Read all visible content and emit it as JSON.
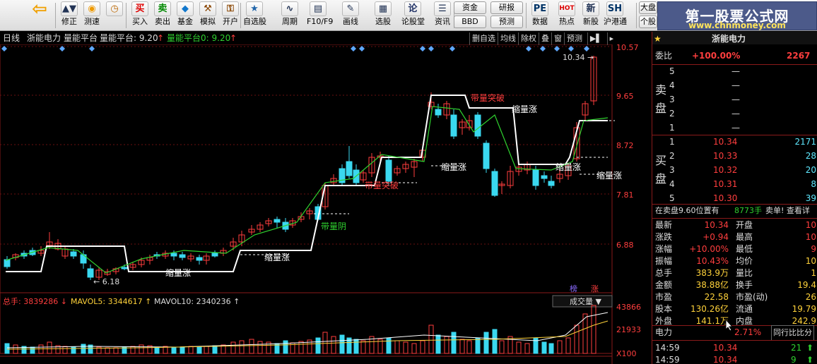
{
  "toolbar": {
    "buttons": [
      {
        "label": "修正",
        "icon": "up-down-arrows-icon",
        "icon_text": "▲▼"
      },
      {
        "label": "测速",
        "icon": "lightbulb-icon",
        "icon_text": "◉"
      },
      {
        "label": "",
        "icon": "clock-icon",
        "icon_text": "◷"
      },
      {
        "label": "买入",
        "icon": "buy-icon",
        "icon_text": "买"
      },
      {
        "label": "卖出",
        "icon": "sell-icon",
        "icon_text": "卖"
      },
      {
        "label": "基金",
        "icon": "fund-icon",
        "icon_text": "◆"
      },
      {
        "label": "模拟",
        "icon": "gavel-icon",
        "icon_text": "⚒"
      },
      {
        "label": "开户",
        "icon": "lock-icon",
        "icon_text": "⚿"
      },
      {
        "label": "自选股",
        "icon": "star-icon",
        "icon_text": "★"
      },
      {
        "label": "周期",
        "icon": "period-icon",
        "icon_text": "∿"
      },
      {
        "label": "F10/F9",
        "icon": "f10-icon",
        "icon_text": "▤"
      },
      {
        "label": "画线",
        "icon": "pen-icon",
        "icon_text": "✎"
      },
      {
        "label": "选股",
        "icon": "select-stock-icon",
        "icon_text": "▦"
      },
      {
        "label": "论股堂",
        "icon": "forum-icon",
        "icon_text": "论"
      },
      {
        "label": "资讯",
        "icon": "news-icon",
        "icon_text": "☰"
      },
      {
        "label": "数据",
        "icon": "pe-icon",
        "icon_text": "PE"
      },
      {
        "label": "热点",
        "icon": "hot-icon",
        "icon_text": "HOT"
      },
      {
        "label": "新股",
        "icon": "new-stock-icon",
        "icon_text": "新"
      },
      {
        "label": "沪港通",
        "icon": "hk-connect-icon",
        "icon_text": "SH"
      }
    ],
    "pills": {
      "fund": "资金",
      "research": "研报",
      "bbd": "BBD",
      "forecast": "预测",
      "market": "大盘",
      "personal": "个股"
    }
  },
  "logo": {
    "title": "第一股票公式网",
    "url": "www.chnmoney.com"
  },
  "header": {
    "period": "日线",
    "stock": "浙能电力",
    "indicator": "量能平台",
    "indicator_value": "量能平台: 9.20",
    "indicator2_value": "量能平台0: 9.20",
    "buttons": [
      "删自选",
      "均线",
      "除权",
      "叠",
      "窗",
      "预测"
    ]
  },
  "chart_data": {
    "type": "candlestick",
    "price_axis": [
      "10.57",
      "9.65",
      "8.72",
      "7.81",
      "6.88"
    ],
    "volume_axis": [
      "43866",
      "21933",
      "X100"
    ],
    "markers": {
      "high": "10.34",
      "low": "6.18"
    },
    "annotations": [
      "缩量涨",
      "缩量涨",
      "带量阴",
      "带量突破",
      "缩量涨",
      "带量突破",
      "缩量涨",
      "缩量涨",
      "缩量涨"
    ],
    "volume_header": {
      "total": "总手: 3839286",
      "mavol5": "MAVOL5: 3344617",
      "mavol10": "MAVOL10: 2340236"
    },
    "volume_selector": "成交量",
    "tags": [
      "榜",
      "涨"
    ]
  },
  "quote": {
    "title": "浙能电力",
    "weibi_label": "委比",
    "weibi_value": "+100.00%",
    "weibi_diff": "2267",
    "sell_side_label": "卖盘",
    "buy_side_label": "买盘",
    "asks": [
      {
        "level": "5",
        "price": "—",
        "vol": ""
      },
      {
        "level": "4",
        "price": "—",
        "vol": ""
      },
      {
        "level": "3",
        "price": "—",
        "vol": ""
      },
      {
        "level": "2",
        "price": "—",
        "vol": ""
      },
      {
        "level": "1",
        "price": "—",
        "vol": ""
      }
    ],
    "bids": [
      {
        "level": "1",
        "price": "10.34",
        "vol": "2171"
      },
      {
        "level": "2",
        "price": "10.33",
        "vol": "28"
      },
      {
        "level": "3",
        "price": "10.32",
        "vol": "20"
      },
      {
        "level": "4",
        "price": "10.31",
        "vol": "8"
      },
      {
        "level": "5",
        "price": "10.30",
        "vol": "39"
      }
    ],
    "notice": "在卖盘9.60位置有",
    "notice_vol": "8773手",
    "notice_tail": "卖单! 查看详",
    "stats": [
      [
        "最新",
        "10.34",
        "开盘",
        "10"
      ],
      [
        "涨跌",
        "+0.94",
        "最高",
        "10"
      ],
      [
        "涨幅",
        "+10.00%",
        "最低",
        "9"
      ],
      [
        "振幅",
        "10.43%",
        "均价",
        "10"
      ],
      [
        "总手",
        "383.9万",
        "量比",
        "1"
      ],
      [
        "金额",
        "38.88亿",
        "换手",
        "19.4"
      ],
      [
        "市盈",
        "22.58",
        "市盈(动)",
        "26"
      ],
      [
        "股本",
        "130.26亿",
        "流通",
        "19.79"
      ],
      [
        "外盘",
        "141.1万",
        "内盘",
        "242.9"
      ]
    ],
    "sector": "电力",
    "sector_pct": "2.71%",
    "rank_label": "同行比比分",
    "ticks": [
      {
        "time": "14:59",
        "price": "10.34",
        "vol": "21"
      },
      {
        "time": "14:59",
        "price": "10.34",
        "vol": "9"
      }
    ]
  }
}
